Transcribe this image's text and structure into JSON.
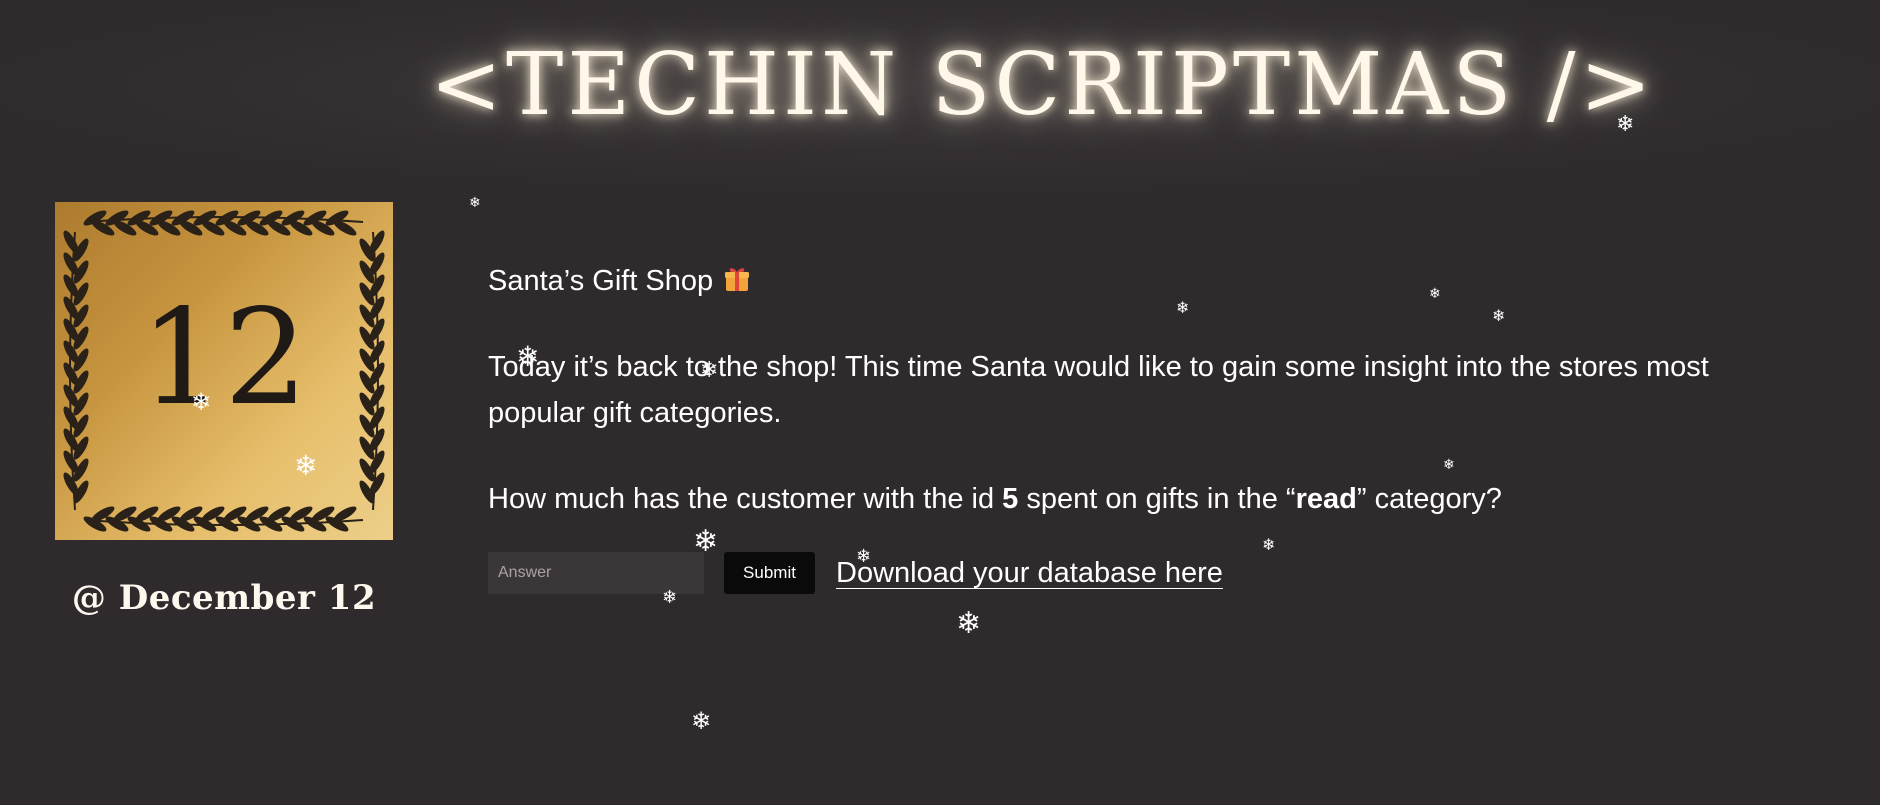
{
  "header": {
    "title": "<TECHIN SCRIPTMAS />"
  },
  "calendar": {
    "day_number": "12",
    "date_label": "@ December 12"
  },
  "puzzle": {
    "title": "Santa’s Gift Shop",
    "title_icon": "gift-icon",
    "intro": "Today it’s back to the shop! This time Santa would like to gain some insight into the stores most popular gift categories.",
    "question_part1": "How much has the customer with the id ",
    "question_id": "5",
    "question_part2": " spent on gifts in the “",
    "question_category": "read",
    "question_part3": "” category?"
  },
  "answer_form": {
    "placeholder": "Answer",
    "value": "",
    "submit_label": "Submit",
    "download_label": "Download your database here"
  },
  "decorations": {
    "snowflake_icon": "snowflake-icon",
    "snowflake_glyph": "❄"
  },
  "colors": {
    "background": "#2f2b2d",
    "tile_gold_dark": "#ad7b2e",
    "tile_gold_light": "#eccf89",
    "glow": "#fff8ea"
  }
}
